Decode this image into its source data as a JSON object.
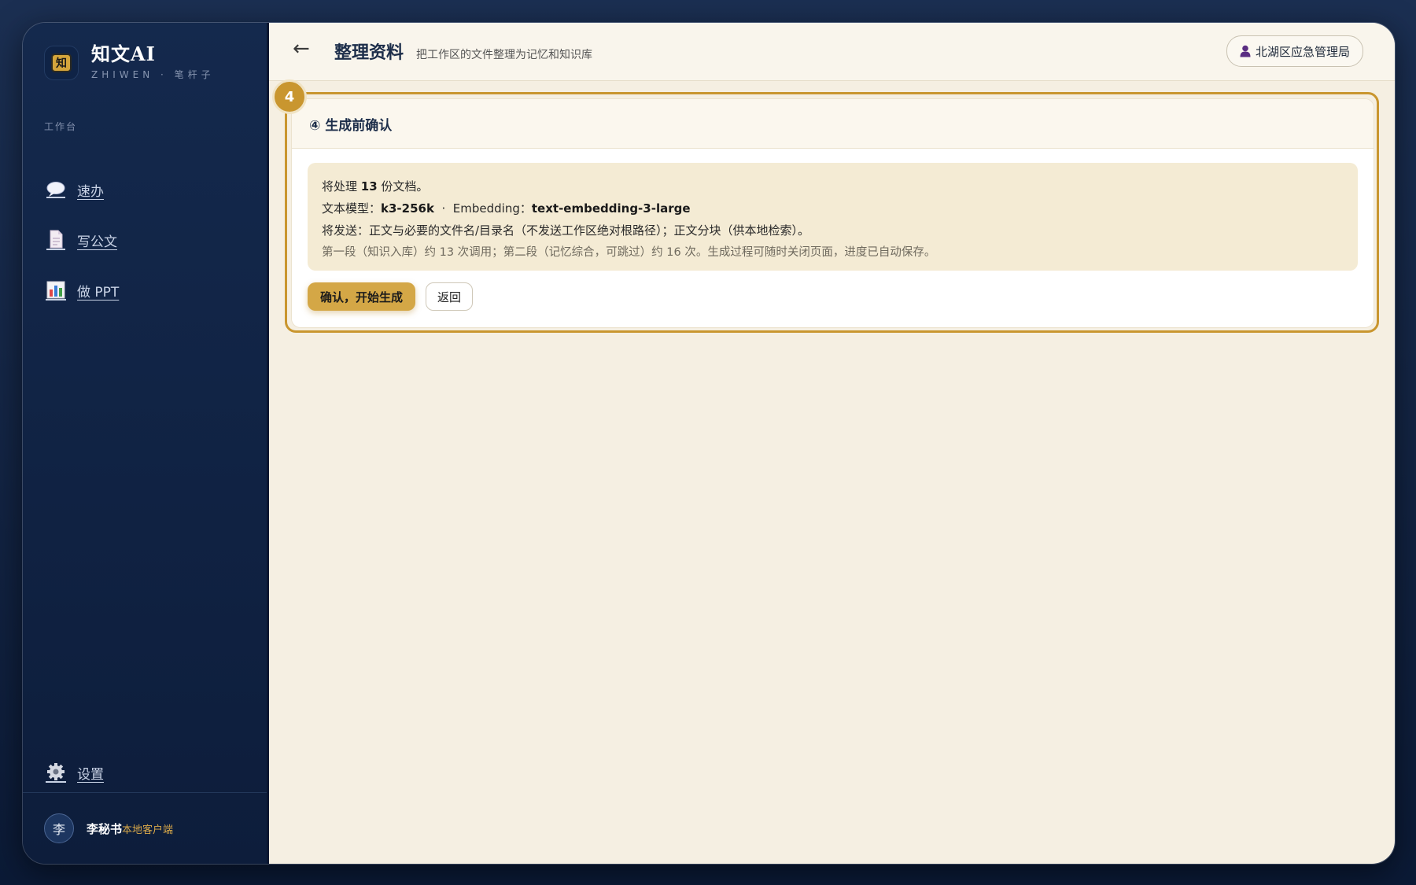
{
  "brand": {
    "name": "知文AI",
    "logo_char": "知",
    "subtitle": "ZHIWEN · 笔杆子"
  },
  "sidebar": {
    "section_label": "工作台",
    "items": [
      {
        "label": "速办",
        "icon": "speech-bubble-icon"
      },
      {
        "label": "写公文",
        "icon": "document-icon"
      },
      {
        "label": "做 PPT",
        "icon": "bar-chart-icon"
      }
    ],
    "settings": {
      "label": "设置",
      "icon": "gear-icon"
    },
    "user": {
      "avatar_char": "李",
      "name": "李秘书",
      "tag": "本地客户端"
    }
  },
  "header": {
    "back_icon": "←",
    "title": "整理资料",
    "subtitle": "把工作区的文件整理为记忆和知识库",
    "org": "北湖区应急管理局"
  },
  "step": {
    "badge": "4",
    "title": "④ 生成前确认",
    "line1": {
      "prefix": "将处理 ",
      "count": "13",
      "suffix": " 份文档。"
    },
    "line2": {
      "model_label": "文本模型：",
      "model": "k3-256k",
      "sep": "  ·  ",
      "embed_label": "Embedding：",
      "embed": "text-embedding-3-large"
    },
    "line3": "将发送：正文与必要的文件名/目录名（不发送工作区绝对根路径）；正文分块（供本地检索）。",
    "line4": "第一段（知识入库）约 13 次调用；第二段（记忆综合，可跳过）约 16 次。生成过程可随时关闭页面，进度已自动保存。",
    "confirm_button": "确认，开始生成",
    "back_button": "返回"
  },
  "colors": {
    "accent": "#c9962f",
    "sidebar_bg": "#14294d",
    "main_bg": "#f5efe2"
  }
}
